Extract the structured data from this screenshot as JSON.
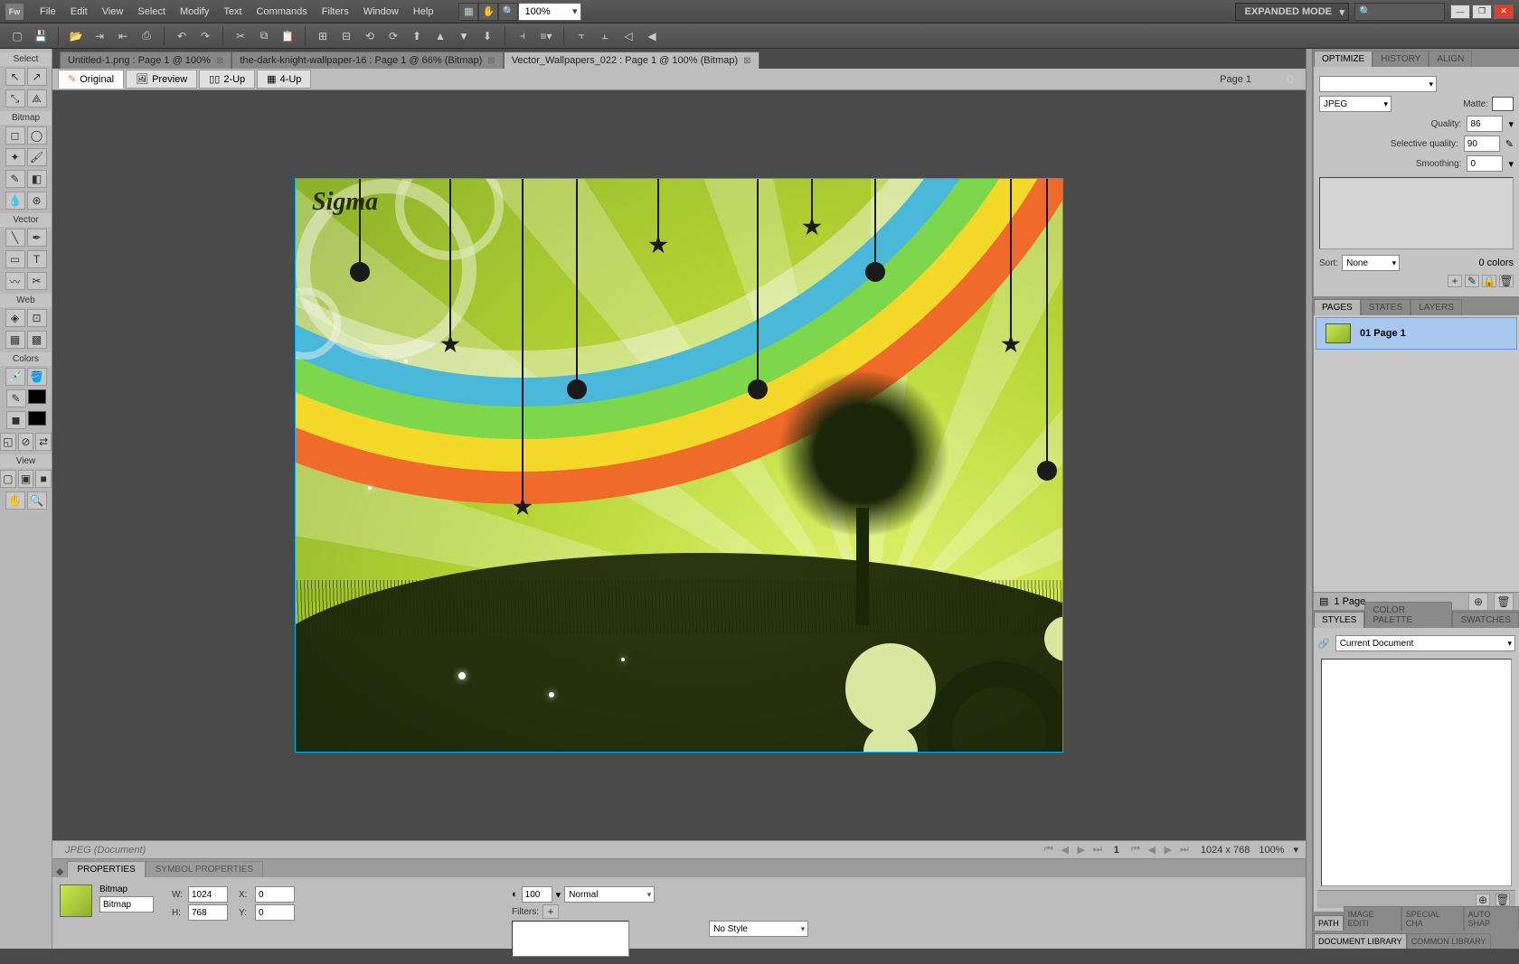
{
  "app": {
    "logo": "Fw",
    "mode": "EXPANDED MODE"
  },
  "menu": [
    "File",
    "Edit",
    "View",
    "Select",
    "Modify",
    "Text",
    "Commands",
    "Filters",
    "Window",
    "Help"
  ],
  "zoom": "100%",
  "doc_tabs": [
    {
      "label": "Untitled-1.png : Page 1 @ 100%",
      "active": false
    },
    {
      "label": "the-dark-knight-wallpaper-16 : Page 1 @  66% (Bitmap)",
      "active": false
    },
    {
      "label": "Vector_Wallpapers_022 : Page 1 @ 100% (Bitmap)",
      "active": true
    }
  ],
  "view_tabs": {
    "original": "Original",
    "preview": "Preview",
    "two_up": "2-Up",
    "four_up": "4-Up",
    "page": "Page 1"
  },
  "status": {
    "info": "JPEG (Document)",
    "page": "1",
    "dims": "1024 x 768",
    "zoom": "100%"
  },
  "canvas": {
    "watermark": "Sigma"
  },
  "toolbox": {
    "select": "Select",
    "bitmap": "Bitmap",
    "vector": "Vector",
    "web": "Web",
    "colors": "Colors",
    "view": "View"
  },
  "optimize": {
    "tabs": [
      "OPTIMIZE",
      "HISTORY",
      "ALIGN"
    ],
    "format": "JPEG",
    "matte": "Matte:",
    "quality_label": "Quality:",
    "quality": "86",
    "selq_label": "Selective quality:",
    "selq": "90",
    "smooth_label": "Smoothing:",
    "smooth": "0",
    "sort_label": "Sort:",
    "sort": "None",
    "colors": "0 colors"
  },
  "pages": {
    "tabs": [
      "PAGES",
      "STATES",
      "LAYERS"
    ],
    "item": "01  Page 1",
    "footer": "1 Page"
  },
  "styles": {
    "tabs": [
      "STYLES",
      "COLOR PALETTE",
      "SWATCHES"
    ],
    "scope": "Current Document"
  },
  "bottom_tabs1": [
    "PATH",
    "IMAGE EDITI",
    "SPECIAL CHA",
    "AUTO SHAP"
  ],
  "bottom_tabs2": [
    "DOCUMENT LIBRARY",
    "COMMON LIBRARY"
  ],
  "properties": {
    "tabs": [
      "PROPERTIES",
      "SYMBOL PROPERTIES"
    ],
    "type": "Bitmap",
    "name": "Bitmap",
    "w": "1024",
    "h": "768",
    "x": "0",
    "y": "0",
    "opacity": "100",
    "blend": "Normal",
    "filters": "Filters:",
    "style": "No Style"
  }
}
